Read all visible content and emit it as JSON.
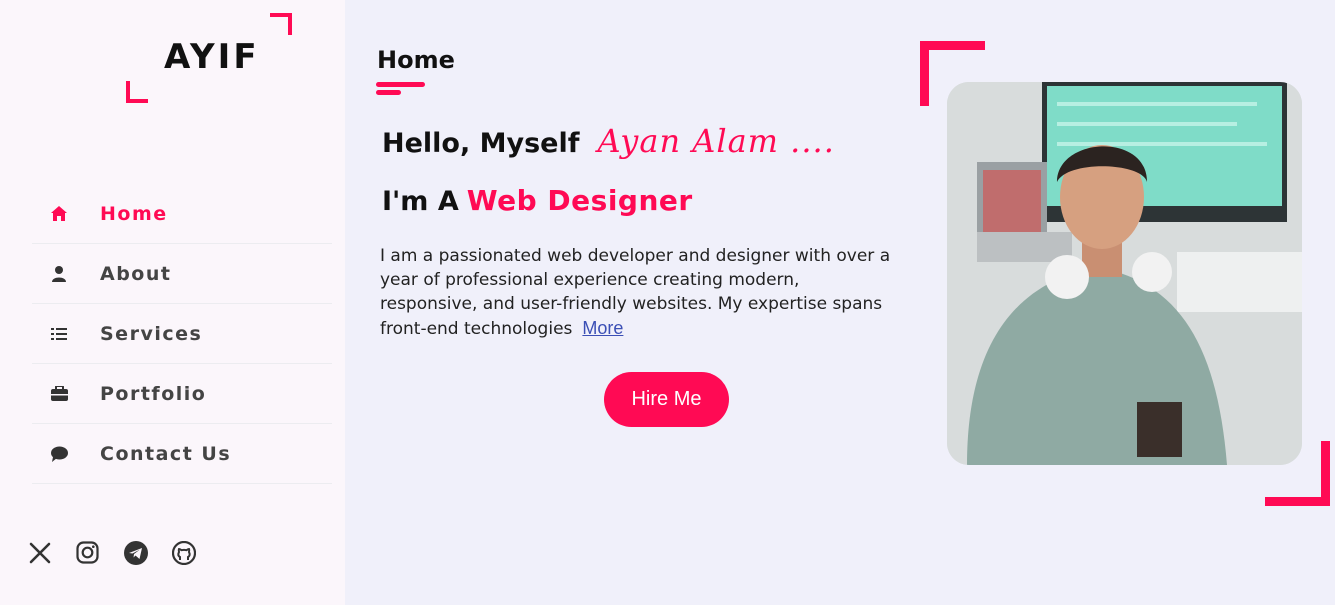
{
  "logo": {
    "text": "AYIF"
  },
  "nav": {
    "items": [
      {
        "label": "Home",
        "icon": "home-icon",
        "active": true
      },
      {
        "label": "About",
        "icon": "user-icon",
        "active": false
      },
      {
        "label": "Services",
        "icon": "list-icon",
        "active": false
      },
      {
        "label": "Portfolio",
        "icon": "briefcase-icon",
        "active": false
      },
      {
        "label": "Contact Us",
        "icon": "chat-icon",
        "active": false
      }
    ]
  },
  "socials": [
    "x-icon",
    "instagram-icon",
    "telegram-icon",
    "github-icon"
  ],
  "main": {
    "section_title": "Home",
    "hello_text": "Hello, Myself",
    "hello_name": "Ayan  Alam ....",
    "role_prefix": "I'm A",
    "role_title": "Web Designer",
    "bio": "I am a passionated web developer and designer with over a year of professional experience creating modern, responsive, and user-friendly websites. My expertise spans front-end technologies",
    "more_label": "More",
    "hire_label": "Hire Me"
  },
  "colors": {
    "accent": "#ff0a54",
    "background": "#f0f0fa",
    "sidebar": "#fbf6fb"
  }
}
